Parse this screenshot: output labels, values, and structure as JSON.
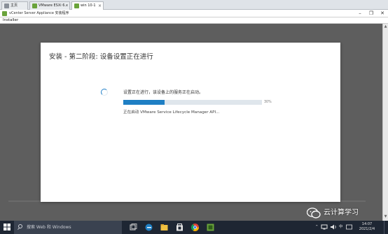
{
  "tabs": [
    {
      "label": "主页",
      "active": false
    },
    {
      "label": "VMware ESXi 6.x",
      "active": false
    },
    {
      "label": "win 10-1",
      "active": true
    }
  ],
  "window": {
    "title": "vCenter Server Appliance 安装程序",
    "minimize_glyph": "–",
    "maximize_glyph": "❐",
    "close_glyph": "✕"
  },
  "menu": {
    "installer_label": "Installer"
  },
  "dialog": {
    "title": "安装 - 第二阶段: 设备设置正在进行",
    "status_text": "设置正在进行，该设备上的服务正在启动。",
    "progress_percent": 30,
    "progress_label": "30%",
    "substatus": "正在启动 VMware Service Lifecycle Manager API..."
  },
  "taskbar": {
    "search_placeholder": "搜索 Web 和 Windows",
    "icons": [
      "task-view-icon",
      "edge-icon",
      "file-explorer-icon",
      "store-icon",
      "chrome-icon",
      "vcsa-installer-icon"
    ],
    "ime_label": "中",
    "clock_time": "14:07",
    "clock_date": "2021/2/4"
  },
  "watermark": {
    "text": "云计算学习"
  },
  "colors": {
    "accent": "#1f7fc4",
    "taskbar": "#1e2633",
    "overlay": "#5e5e5e"
  }
}
